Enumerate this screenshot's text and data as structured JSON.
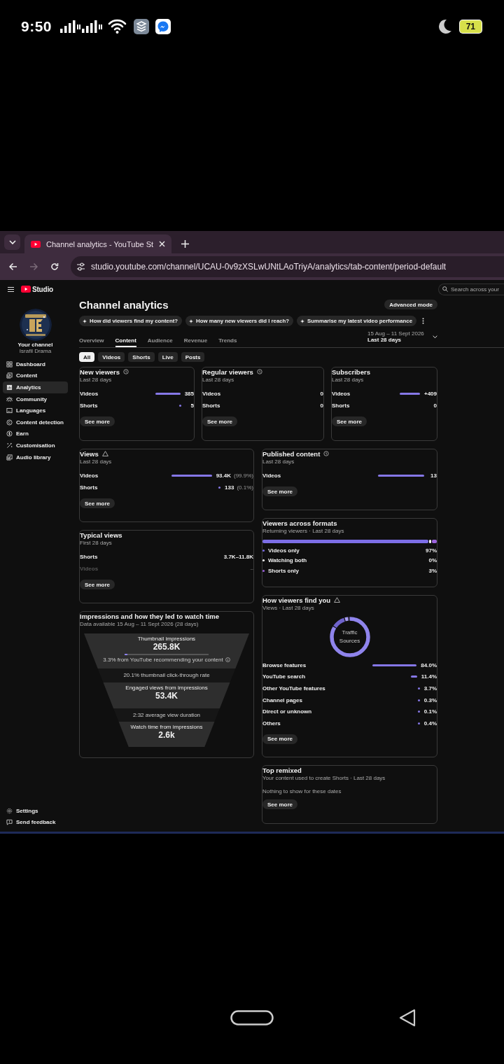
{
  "status_bar": {
    "time": "9:50",
    "battery": "71"
  },
  "browser": {
    "tabs": [
      {
        "title": "Channel analytics - YouTube St",
        "selected": true
      }
    ],
    "url": "studio.youtube.com/channel/UCAU-0v9zXSLwUNtLAoTriyA/analytics/tab-content/period-default"
  },
  "studio": {
    "logo": "Studio",
    "search": {
      "placeholder": "Search across your"
    }
  },
  "sidebar": {
    "channel_label": "Your channel",
    "channel_name": "Israfil Drama",
    "items": [
      {
        "label": "Dashboard",
        "kind": "dashboard",
        "selected": false
      },
      {
        "label": "Content",
        "kind": "content",
        "selected": false
      },
      {
        "label": "Analytics",
        "kind": "analytics",
        "selected": true
      },
      {
        "label": "Community",
        "kind": "community",
        "selected": false
      },
      {
        "label": "Languages",
        "kind": "languages",
        "selected": false
      },
      {
        "label": "Content detection",
        "kind": "copyright",
        "selected": false
      },
      {
        "label": "Earn",
        "kind": "earn",
        "selected": false
      },
      {
        "label": "Customisation",
        "kind": "customisation",
        "selected": false
      },
      {
        "label": "Audio library",
        "kind": "audio",
        "selected": false
      }
    ],
    "footer_items": [
      {
        "label": "Settings",
        "kind": "settings"
      },
      {
        "label": "Send feedback",
        "kind": "feedback"
      }
    ]
  },
  "header": {
    "title": "Channel analytics",
    "advanced_button": "Advanced mode",
    "suggestions": [
      "How did viewers find my content?",
      "How many new viewers did I reach?",
      "Summarise my latest video performance"
    ],
    "tabs": [
      {
        "label": "Overview",
        "selected": false
      },
      {
        "label": "Content",
        "selected": true
      },
      {
        "label": "Audience",
        "selected": false
      },
      {
        "label": "Revenue",
        "selected": false
      },
      {
        "label": "Trends",
        "selected": false
      }
    ],
    "date_range": {
      "dates": "15 Aug – 11 Sept 2026",
      "label": "Last 28 days"
    }
  },
  "filters": [
    {
      "label": "All",
      "selected": true
    },
    {
      "label": "Videos",
      "selected": false
    },
    {
      "label": "Shorts",
      "selected": false
    },
    {
      "label": "Live",
      "selected": false
    },
    {
      "label": "Posts",
      "selected": false
    }
  ],
  "top_cards": [
    {
      "kind": "metric",
      "title": "New viewers",
      "info": true,
      "warning": false,
      "subtitle": "Last 28 days",
      "rows": [
        {
          "label": "Videos",
          "value": "385",
          "kind": "bar"
        },
        {
          "label": "Shorts",
          "value": "5",
          "kind": "dot"
        }
      ],
      "button": "See more"
    },
    {
      "kind": "metric",
      "title": "Regular viewers",
      "info": true,
      "warning": false,
      "subtitle": "Last 28 days",
      "rows": [
        {
          "label": "Videos",
          "value": "0",
          "kind": "plain"
        },
        {
          "label": "Shorts",
          "value": "0",
          "kind": "plain"
        }
      ],
      "button": "See more"
    },
    {
      "kind": "metric",
      "title": "Subscribers",
      "info": false,
      "warning": false,
      "subtitle": "Last 28 days",
      "rows": [
        {
          "label": "Videos",
          "value": "+409",
          "kind": "bar"
        },
        {
          "label": "Shorts",
          "value": "0",
          "kind": "plain"
        }
      ],
      "button": "See more"
    }
  ],
  "left_cards": [
    {
      "kind": "metric",
      "title": "Views",
      "info": false,
      "warning": true,
      "subtitle": "Last 28 days",
      "rows": [
        {
          "label": "Videos",
          "value": "93.4K",
          "share": "(99.9%)",
          "kind": "bar"
        },
        {
          "label": "Shorts",
          "value": "133",
          "share": "(0.1%)",
          "kind": "dot"
        }
      ],
      "button": "See more"
    },
    {
      "kind": "metric",
      "title": "Typical views",
      "info": false,
      "warning": false,
      "subtitle": "First 28 days",
      "rows": [
        {
          "label": "Shorts",
          "value": "3.7K–11.8K",
          "kind": "plain",
          "dimmed": false
        },
        {
          "label": "Videos",
          "value": "–",
          "kind": "plain",
          "dimmed": true
        }
      ],
      "button": "See more"
    },
    {
      "kind": "funnel",
      "title": "Impressions and how they led to watch time",
      "subtitle": "Data available 15 Aug – 11 Sept 2026 (28 days)",
      "steps": [
        {
          "kind": "stage",
          "label": "Thumbnail impressions",
          "value": "265.8K",
          "note": "3.3% from YouTube recommending your content",
          "level": 0.033
        },
        {
          "kind": "rate",
          "label": "20.1% thumbnail click-through rate"
        },
        {
          "kind": "stage",
          "label": "Engaged views from impressions",
          "value": "53.4K"
        },
        {
          "kind": "rate",
          "label": "2:32 average view duration"
        },
        {
          "kind": "stage",
          "label": "Watch time from impressions",
          "value": "2.6k"
        }
      ]
    }
  ],
  "right_cards": [
    {
      "kind": "metric",
      "title": "Published content",
      "info": true,
      "warning": false,
      "subtitle": "Last 28 days",
      "rows": [
        {
          "label": "Videos",
          "value": "13",
          "kind": "bar"
        }
      ],
      "button": "See more"
    },
    {
      "kind": "formats",
      "title": "Viewers across formats",
      "subtitle": "Returning viewers · Last 28 days",
      "segments": [
        {
          "label": "Videos only",
          "value": "97%",
          "level": 0.97,
          "color": "#7c6ee6"
        },
        {
          "label": "Watching both",
          "value": "0%",
          "level": 0.012,
          "color": "#ffffff"
        },
        {
          "label": "Shorts only",
          "value": "3%",
          "level": 0.03,
          "color": "#9b63dc"
        }
      ]
    },
    {
      "kind": "sources",
      "title": "How viewers find you",
      "info": false,
      "warning": true,
      "subtitle": "Views · Last 28 days",
      "center_label": "Traffic Sources",
      "rows": [
        {
          "label": "Browse features",
          "value": "84.0%",
          "kind": "long"
        },
        {
          "label": "YouTube search",
          "value": "11.4%",
          "kind": "short"
        },
        {
          "label": "Other YouTube features",
          "value": "3.7%",
          "kind": "dot"
        },
        {
          "label": "Channel pages",
          "value": "0.3%",
          "kind": "dot"
        },
        {
          "label": "Direct or unknown",
          "value": "0.1%",
          "kind": "dot"
        },
        {
          "label": "Others",
          "value": "0.4%",
          "kind": "dot"
        }
      ],
      "button": "See more"
    },
    {
      "kind": "empty",
      "title": "Top remixed",
      "subtitle": "Your content used to create Shorts · Last 28 days",
      "message": "Nothing to show for these dates",
      "button": "See more"
    }
  ]
}
